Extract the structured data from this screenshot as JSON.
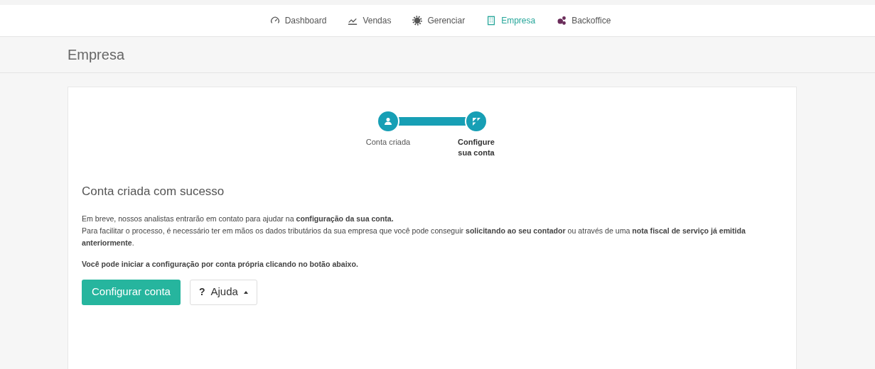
{
  "nav": [
    {
      "label": "Dashboard",
      "kind": "gauge",
      "selected": false
    },
    {
      "label": "Vendas",
      "kind": "chart",
      "selected": false
    },
    {
      "label": "Gerenciar",
      "kind": "gear",
      "selected": false
    },
    {
      "label": "Empresa",
      "kind": "building",
      "selected": true
    },
    {
      "label": "Backoffice",
      "kind": "gears",
      "selected": false
    }
  ],
  "page_title": "Empresa",
  "steps": [
    {
      "label": "Conta criada",
      "kind": "user",
      "current": false
    },
    {
      "label": "Configure sua conta",
      "kind": "flag",
      "current": true
    }
  ],
  "heading": "Conta criada com sucesso",
  "paragraphs": [
    {
      "kind": "normal",
      "text": "Em breve, nossos analistas entrarão em contato para ajudar na **configuração da sua conta.**"
    },
    {
      "kind": "normal",
      "text": "Para facilitar o processo, é necessário ter em mãos os dados tributários da sua empresa que você pode conseguir **solicitando ao seu contador** ou através de uma **nota fiscal de serviço já emitida anteriormente**."
    },
    {
      "kind": "bold",
      "text": "Você pode iniciar a configuração por conta própria clicando no botão abaixo."
    }
  ],
  "primary_button": "Configurar conta",
  "help_button": {
    "icon_text": "?",
    "label": "Ajuda"
  }
}
